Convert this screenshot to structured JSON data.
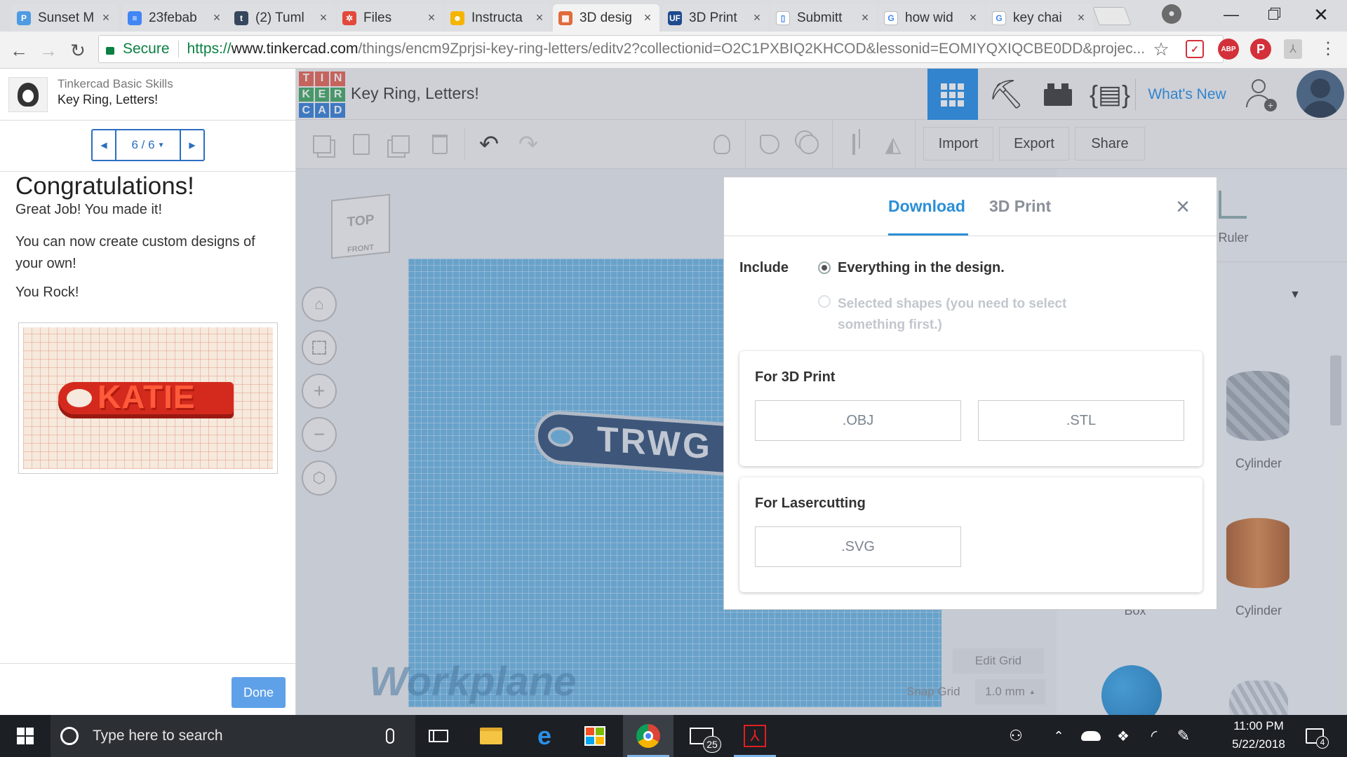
{
  "browser": {
    "tabs": [
      {
        "title": "Sunset M",
        "icon": "p-icon",
        "color": "#4f9be3",
        "glyph": "P"
      },
      {
        "title": "23febab",
        "icon": "docs-icon",
        "color": "#4285f4",
        "glyph": "≡"
      },
      {
        "title": "(2) Tuml",
        "icon": "tumblr-icon",
        "color": "#36465d",
        "glyph": "t"
      },
      {
        "title": "Files",
        "icon": "files-icon",
        "color": "#e4483a",
        "glyph": "✲"
      },
      {
        "title": "Instructa",
        "icon": "instructables-icon",
        "color": "#f5b400",
        "glyph": "☻"
      },
      {
        "title": "3D desig",
        "icon": "tinkercad-icon",
        "color": "#e06c3c",
        "glyph": "▦"
      },
      {
        "title": "3D Print",
        "icon": "uf-icon",
        "color": "#1e4a8f",
        "glyph": "UF"
      },
      {
        "title": "Submitt",
        "icon": "page-icon",
        "color": "#ffffff",
        "glyph": "▯"
      },
      {
        "title": "how wid",
        "icon": "google-icon",
        "color": "#ffffff",
        "glyph": "G"
      },
      {
        "title": "key chai",
        "icon": "google-icon",
        "color": "#ffffff",
        "glyph": "G"
      }
    ],
    "tab_close": "×",
    "secure_label": "Secure",
    "url_scheme": "https://",
    "url_host": "www.tinkercad.com",
    "url_path": "/things/encm9Zprjsi-key-ring-letters/editv2?collectionid=O2C1PXBIQ2KHCOD&lessonid=EOMIYQXIQCBE0DD&projec...",
    "ext_abp": "ABP"
  },
  "lesson": {
    "course": "Tinkercad Basic Skills",
    "title": "Key Ring, Letters!",
    "pager": "6 / 6",
    "heading": "Congratulations!",
    "lines": [
      "Great Job! You made it!",
      "You can now create custom designs of your own!",
      "You Rock!"
    ],
    "image_text": "KATIE",
    "done_label": "Done"
  },
  "tinkercad": {
    "logo": [
      "T",
      "I",
      "N",
      "K",
      "E",
      "R",
      "C",
      "A",
      "D"
    ],
    "design_title": "Key Ring, Letters!",
    "whats_new": "What's New",
    "import_label": "Import",
    "export_label": "Export",
    "share_label": "Share",
    "viewcube_top": "TOP",
    "viewcube_front": "FRONT",
    "workplane_label": "Workplane",
    "object_text": "TRWG",
    "edit_grid": "Edit Grid",
    "snap_grid_label": "Snap Grid",
    "snap_grid_value": "1.0 mm",
    "ruler_label": "Ruler",
    "shapes": [
      {
        "label": "Cylinder",
        "color": "#9aa3ae"
      },
      {
        "label": "Box",
        "color": "#e34b3f"
      },
      {
        "label": "Cylinder",
        "color": "#c9713a"
      },
      {
        "label": "",
        "color": "#1a8fd6"
      },
      {
        "label": "",
        "color": "#b9c2cc"
      }
    ]
  },
  "modal": {
    "tabs": [
      "Download",
      "3D Print"
    ],
    "active_tab": "Download",
    "close": "×",
    "include_label": "Include",
    "option_all": "Everything in the design.",
    "option_selected": "Selected shapes (you need to select something first.)",
    "print_heading": "For 3D Print",
    "print_formats": [
      ".OBJ",
      ".STL"
    ],
    "laser_heading": "For Lasercutting",
    "laser_formats": [
      ".SVG"
    ],
    "accent": "#2b8fd6"
  },
  "taskbar": {
    "search_placeholder": "Type here to search",
    "mail_badge": "25",
    "time": "11:00 PM",
    "date": "5/22/2018",
    "notifications": "4"
  }
}
